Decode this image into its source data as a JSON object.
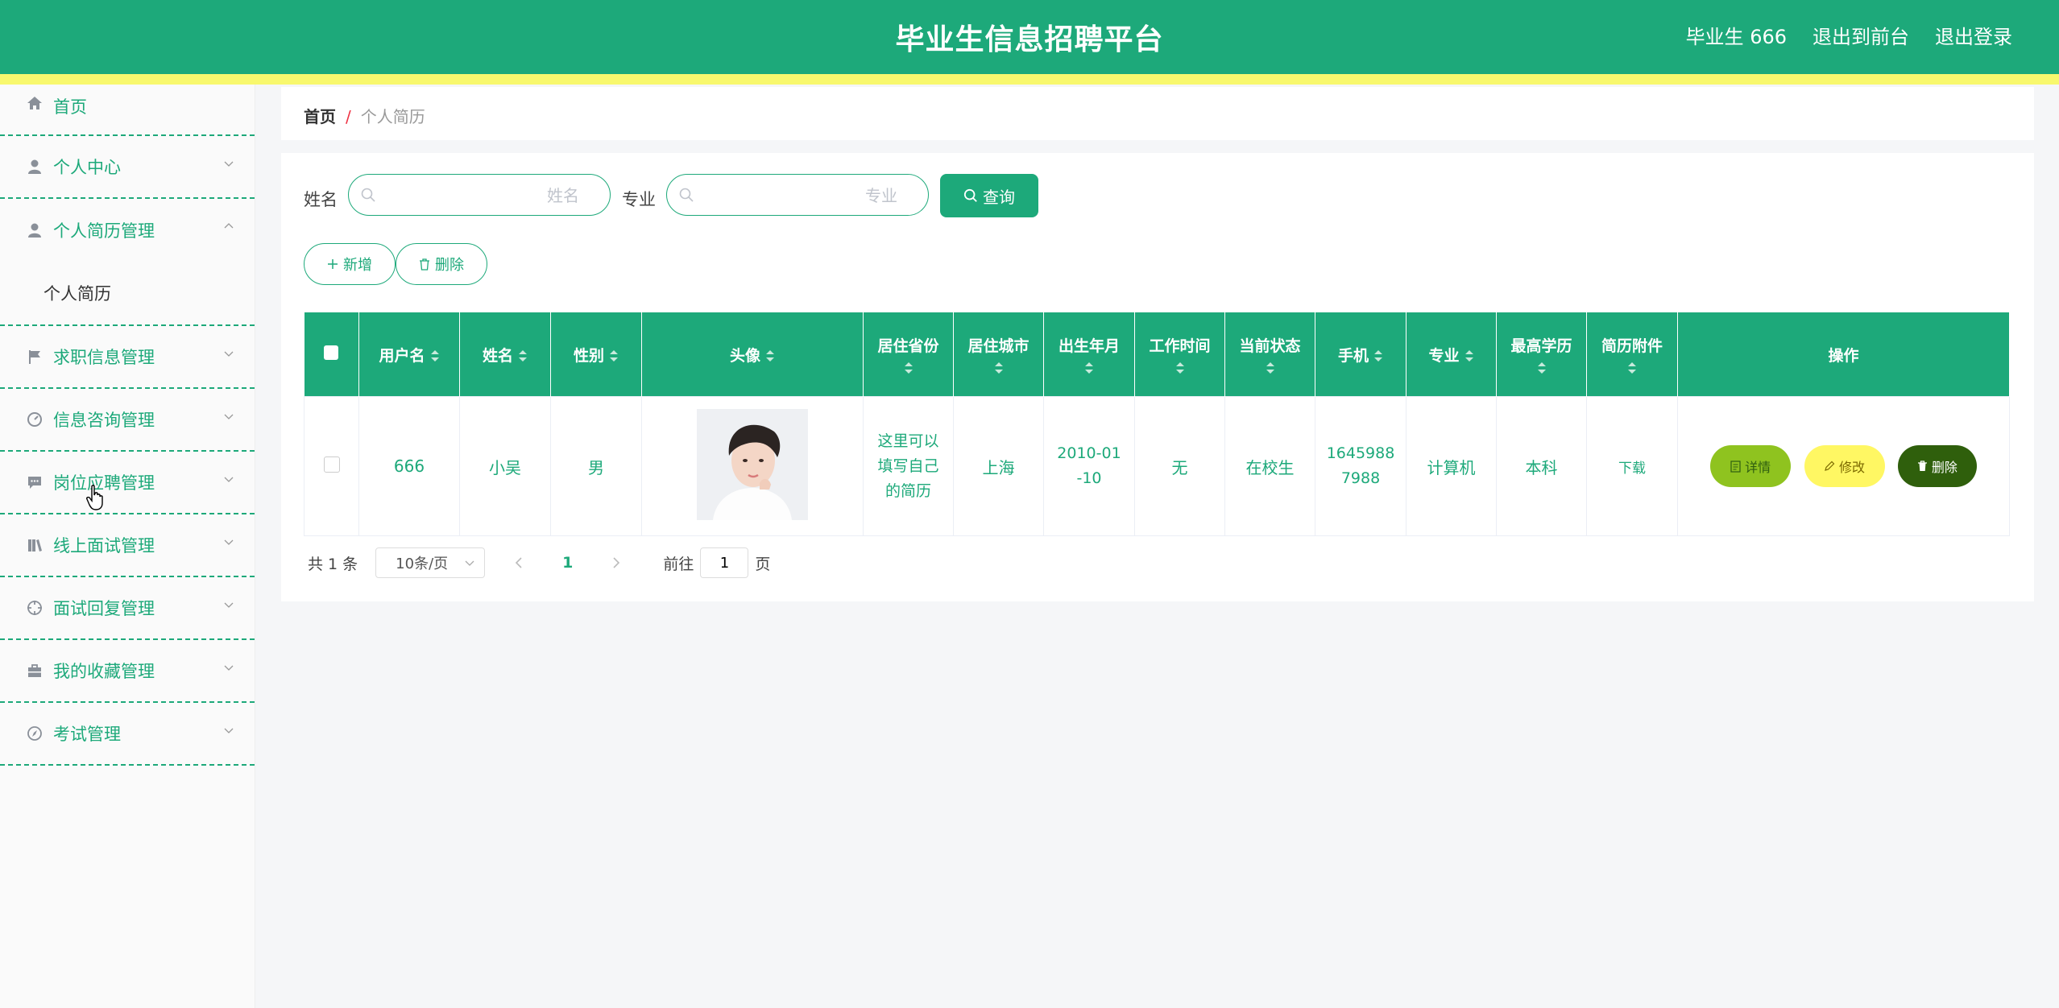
{
  "header": {
    "title": "毕业生信息招聘平台",
    "user_label": "毕业生 666",
    "exit_front": "退出到前台",
    "logout": "退出登录"
  },
  "sidebar": {
    "items": [
      {
        "label": "首页",
        "icon": "home-icon"
      },
      {
        "label": "个人中心",
        "icon": "user-icon"
      },
      {
        "label": "个人简历管理",
        "icon": "user-icon",
        "expanded": true,
        "children": [
          "个人简历"
        ]
      },
      {
        "label": "求职信息管理",
        "icon": "flag-icon"
      },
      {
        "label": "信息咨询管理",
        "icon": "gauge-icon"
      },
      {
        "label": "岗位应聘管理",
        "icon": "chat-icon"
      },
      {
        "label": "线上面试管理",
        "icon": "books-icon"
      },
      {
        "label": "面试回复管理",
        "icon": "crosshair-icon"
      },
      {
        "label": "我的收藏管理",
        "icon": "briefcase-icon"
      },
      {
        "label": "考试管理",
        "icon": "compass-icon"
      }
    ]
  },
  "breadcrumb": {
    "home": "首页",
    "separator": "/",
    "current": "个人简历"
  },
  "filters": {
    "name_label": "姓名",
    "name_placeholder": "姓名",
    "major_label": "专业",
    "major_placeholder": "专业",
    "query_button": "查询",
    "add_button": "新增",
    "delete_button": "删除"
  },
  "table": {
    "columns": [
      "用户名",
      "姓名",
      "性别",
      "头像",
      "居住省份",
      "居住城市",
      "出生年月",
      "工作时间",
      "当前状态",
      "手机",
      "专业",
      "最高学历",
      "简历附件",
      "操作"
    ],
    "rows": [
      {
        "username": "666",
        "name": "小吴",
        "gender": "男",
        "province_line1": "这里可以",
        "province_line2": "填写自己",
        "province_line3": "的简历",
        "city": "上海",
        "birth_line1": "2010-01",
        "birth_line2": "-10",
        "work_time": "无",
        "status": "在校生",
        "phone_line1": "1645988",
        "phone_line2": "7988",
        "major": "计算机",
        "education": "本科",
        "attachment": "下载",
        "actions": {
          "detail": "详情",
          "edit": "修改",
          "delete": "删除"
        }
      }
    ]
  },
  "pagination": {
    "total": "共 1 条",
    "page_size": "10条/页",
    "current_page": "1",
    "goto_label": "前往",
    "goto_value": "1",
    "page_suffix": "页"
  },
  "colors": {
    "primary": "#1da97a",
    "stripe": "#f8f86e",
    "detail": "#8fc31f",
    "edit": "#fff763",
    "delete": "#2f5f0c"
  }
}
